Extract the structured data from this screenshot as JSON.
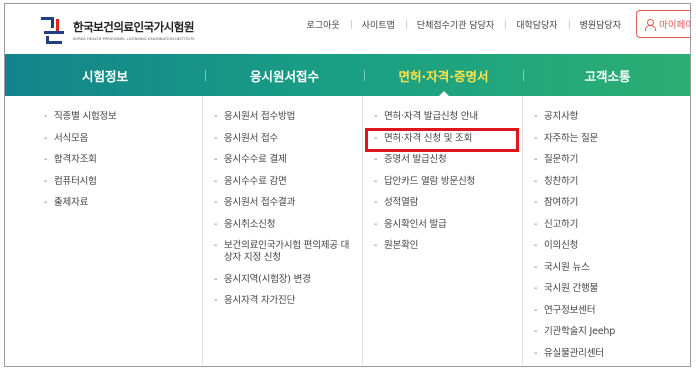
{
  "logo": {
    "name_kr": "한국보건의료인국가시험원",
    "name_en": "KOREA HEALTH PERSONNEL LICENSING EXAMINATION INSTITUTE"
  },
  "util_links": [
    "로그아웃",
    "사이트맵",
    "단체접수기관 담당자",
    "대학담당자",
    "병원담당자"
  ],
  "mypage_label": "마이페이지",
  "gnb": [
    {
      "label": "시험정보",
      "active": false
    },
    {
      "label": "응시원서접수",
      "active": false
    },
    {
      "label": "면허·자격·증명서",
      "active": true
    },
    {
      "label": "고객소통",
      "active": false
    }
  ],
  "menu_columns": [
    {
      "items": [
        "직종별 시험정보",
        "서식모음",
        "합격자조회",
        "컴퓨터시험",
        "출제자료"
      ]
    },
    {
      "items": [
        "응시원서 접수방법",
        "응시원서 접수",
        "응시수수료 결제",
        "응시수수료 감면",
        "응시원서 접수결과",
        "응시취소신청",
        "보건의료인국가시험 편의제공 대상자 지정 신청",
        "응시지역(시험장) 변경",
        "응시자격 자가진단"
      ]
    },
    {
      "items": [
        "면허·자격 발급신청 안내",
        "면허·자격 신청 및 조회",
        "증명서 발급신청",
        "답안카드 열람 방문신청",
        "성적열람",
        "응시확인서 발급",
        "원본확인"
      ]
    },
    {
      "items": [
        "공지사항",
        "자주하는 질문",
        "질문하기",
        "칭찬하기",
        "참여하기",
        "신고하기",
        "이의신청",
        "국시원 뉴스",
        "국시원 간행물",
        "연구정보센터",
        "기관학술지 Jeehp",
        "유실물관리센터"
      ]
    }
  ],
  "highlighted_item": "면허·자격 신청 및 조회",
  "colors": {
    "gnb_start": "#12848a",
    "gnb_end": "#2cae72",
    "active_menu": "#ffe24a",
    "highlight_box": "#e0151f",
    "mypage_accent": "#e25c4d"
  }
}
